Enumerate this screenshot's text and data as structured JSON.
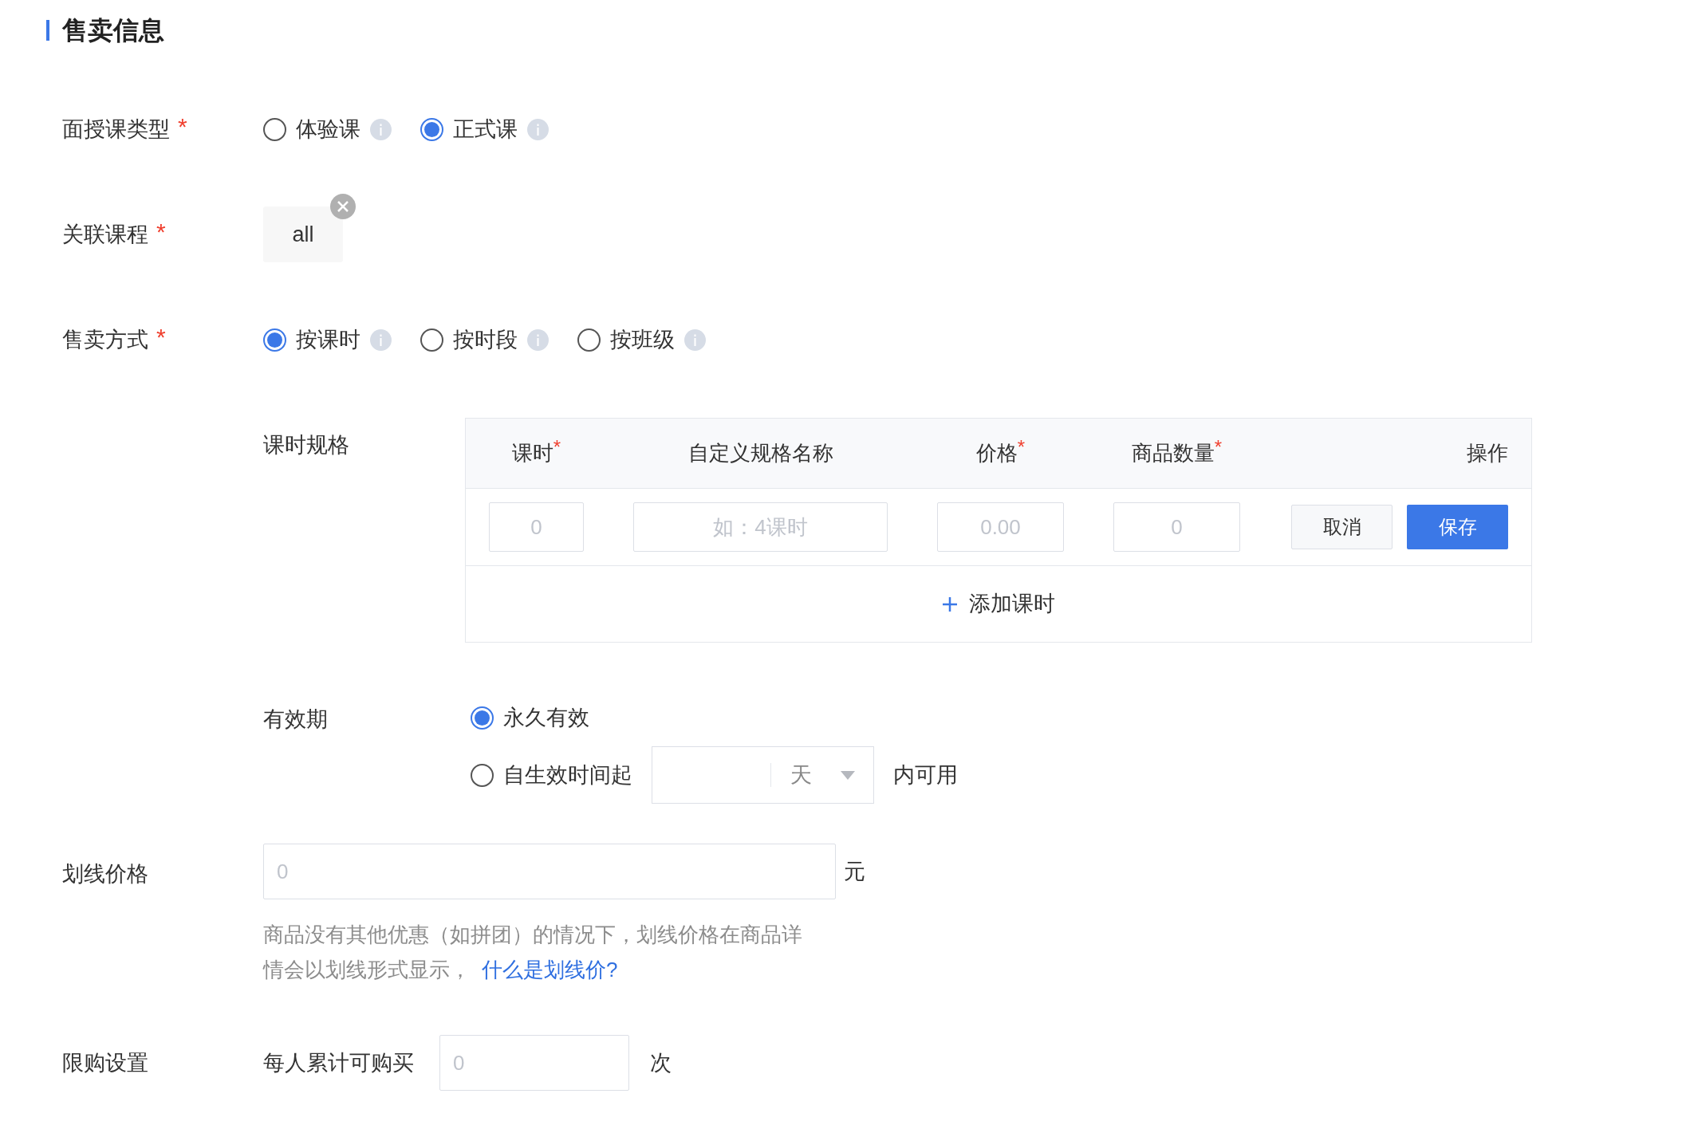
{
  "section_title": "售卖信息",
  "fields": [
    {
      "kind": "radio",
      "label": "面授课类型",
      "required_mark": "*",
      "options": [
        {
          "label": "体验课",
          "selected": false,
          "info": true
        },
        {
          "label": "正式课",
          "selected": true,
          "info": true
        }
      ]
    },
    {
      "kind": "tag",
      "label": "关联课程",
      "required_mark": "*",
      "tags": [
        {
          "text": "all",
          "removable": true
        }
      ]
    },
    {
      "kind": "radio",
      "label": "售卖方式",
      "required_mark": "*",
      "options": [
        {
          "label": "按课时",
          "selected": true,
          "info": true
        },
        {
          "label": "按时段",
          "selected": false,
          "info": true
        },
        {
          "label": "按班级",
          "selected": false,
          "info": true
        }
      ]
    }
  ],
  "spec": {
    "label": "课时规格",
    "columns": [
      {
        "label": "课时",
        "required_mark": "*"
      },
      {
        "label": "自定义规格名称"
      },
      {
        "label": "价格",
        "required_mark": "*"
      },
      {
        "label": "商品数量",
        "required_mark": "*"
      },
      {
        "label": "操作"
      }
    ],
    "inputs": [
      {
        "placeholder": "0"
      },
      {
        "placeholder": "如：4课时"
      },
      {
        "placeholder": "0.00"
      },
      {
        "placeholder": "0"
      }
    ],
    "buttons": [
      {
        "label": "取消",
        "primary": false
      },
      {
        "label": "保存",
        "primary": true
      }
    ],
    "add_button": "添加课时"
  },
  "validity": {
    "label": "有效期",
    "options": [
      {
        "kind": "plain",
        "label": "永久有效",
        "selected": true
      },
      {
        "kind": "duration",
        "label": "自生效时间起",
        "selected": false,
        "unit": "天",
        "suffix": "内可用"
      }
    ]
  },
  "strike_price": {
    "label": "划线价格",
    "placeholder": "0",
    "unit": "元",
    "help": "商品没有其他优惠（如拼团）的情况下，划线价格在商品详情会以划线形式显示，",
    "help_link": "什么是划线价?"
  },
  "limit": {
    "label": "限购设置",
    "prefix": "每人累计可购买",
    "placeholder": "0",
    "unit": "次"
  }
}
